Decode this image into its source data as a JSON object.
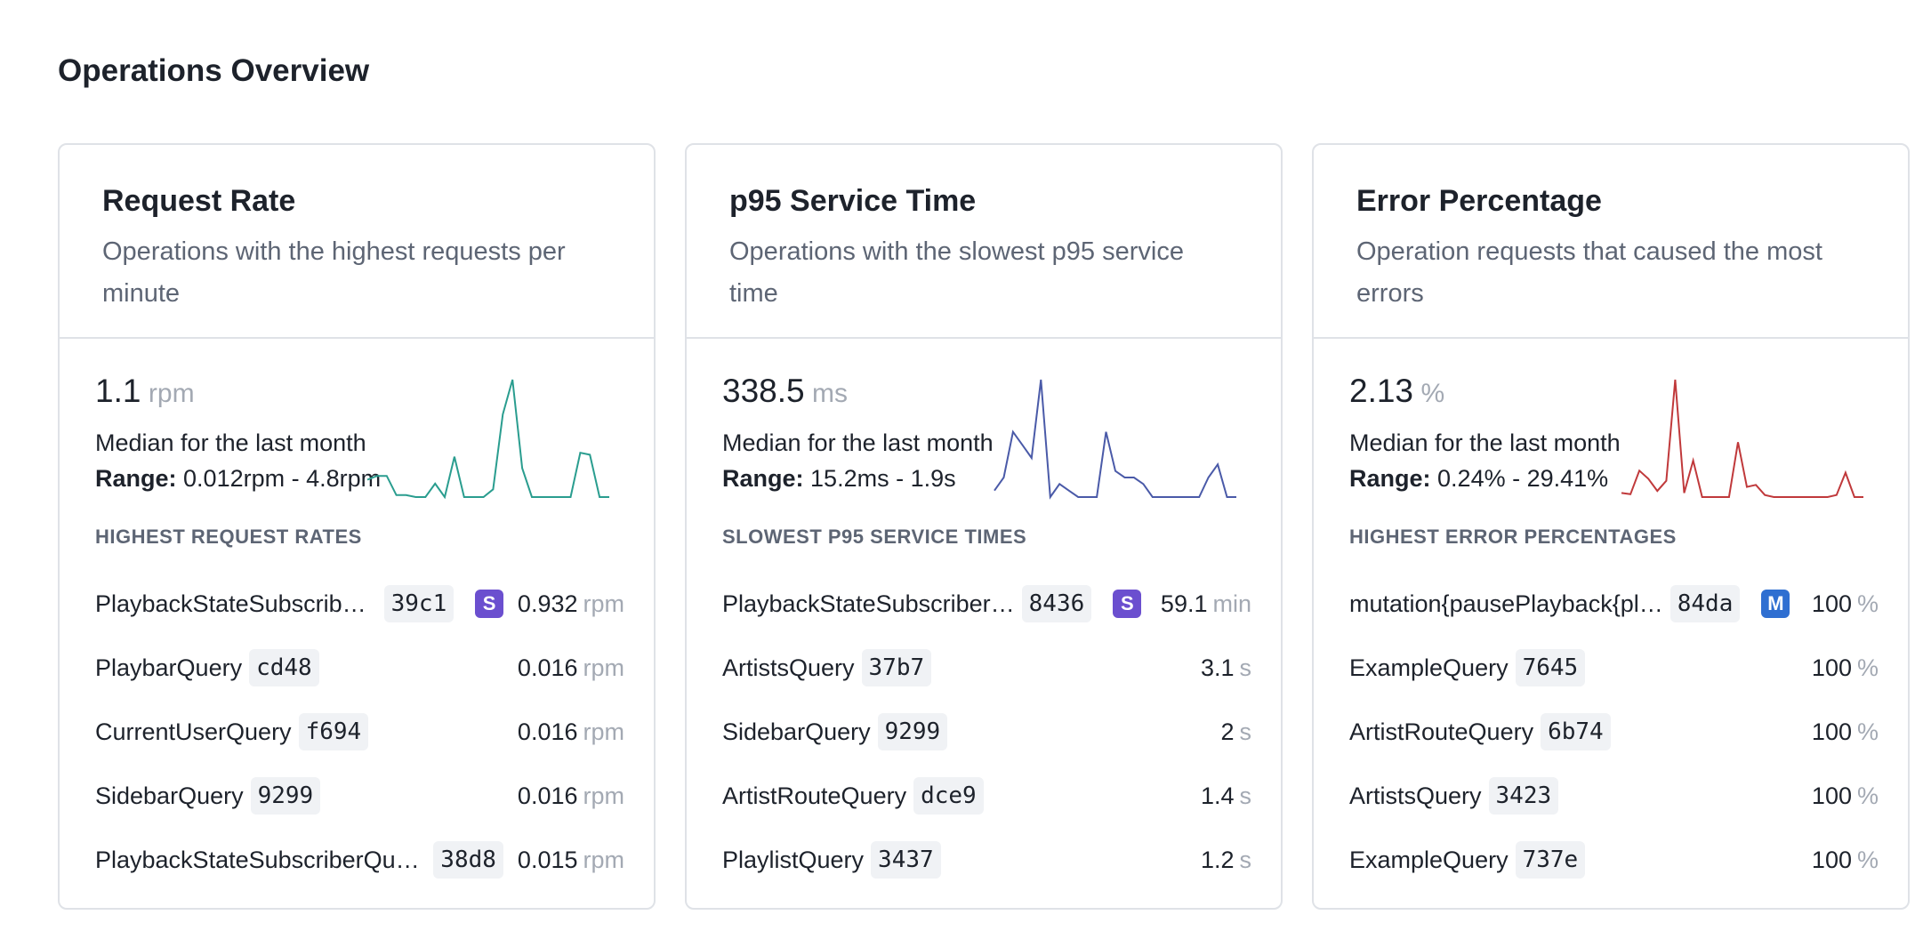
{
  "page": {
    "title": "Operations Overview"
  },
  "colors": {
    "request_rate": "#2a9d8f",
    "service_time": "#4a5aa8",
    "error_percentage": "#c0393b",
    "badge_subscription": "#6b4fcf",
    "badge_mutation": "#2f6fd1"
  },
  "cards": [
    {
      "title": "Request Rate",
      "description": "Operations with the highest requests per minute",
      "metric_value": "1.1",
      "metric_unit": "rpm",
      "median_text": "Median for the last month",
      "range_label": "Range:",
      "range_value": "0.012rpm - 4.8rpm",
      "section_label": "HIGHEST REQUEST RATES",
      "sparkline": [
        0.8,
        0.9,
        0.9,
        0.4,
        0.4,
        0.35,
        0.35,
        0.7,
        0.35,
        1.4,
        0.35,
        0.35,
        0.35,
        0.55,
        2.5,
        3.4,
        1.1,
        0.35,
        0.35,
        0.35,
        0.35,
        0.35,
        1.5,
        1.45,
        0.35,
        0.35
      ],
      "rows": [
        {
          "name": "PlaybackStateSubscribe…",
          "hash": "39c1",
          "badge": "S",
          "value": "0.932",
          "unit": "rpm"
        },
        {
          "name": "PlaybarQuery",
          "hash": "cd48",
          "badge": "",
          "value": "0.016",
          "unit": "rpm"
        },
        {
          "name": "CurrentUserQuery",
          "hash": "f694",
          "badge": "",
          "value": "0.016",
          "unit": "rpm"
        },
        {
          "name": "SidebarQuery",
          "hash": "9299",
          "badge": "",
          "value": "0.016",
          "unit": "rpm"
        },
        {
          "name": "PlaybackStateSubscriberQuery",
          "hash": "38d8",
          "badge": "",
          "value": "0.015",
          "unit": "rpm"
        }
      ]
    },
    {
      "title": "p95 Service Time",
      "description": "Operations with the slowest p95 service time",
      "metric_value": "338.5",
      "metric_unit": "ms",
      "median_text": "Median for the last month",
      "range_label": "Range:",
      "range_value": "15.2ms - 1.9s",
      "section_label": "SLOWEST P95 SERVICE TIMES",
      "sparkline": [
        0.3,
        0.5,
        1.2,
        1.0,
        0.8,
        2.0,
        0.2,
        0.4,
        0.3,
        0.2,
        0.2,
        0.2,
        1.2,
        0.6,
        0.5,
        0.5,
        0.4,
        0.2,
        0.2,
        0.2,
        0.2,
        0.2,
        0.2,
        0.5,
        0.7,
        0.2,
        0.2
      ],
      "rows": [
        {
          "name": "PlaybackStateSubscriber…",
          "hash": "8436",
          "badge": "S",
          "value": "59.1",
          "unit": "min"
        },
        {
          "name": "ArtistsQuery",
          "hash": "37b7",
          "badge": "",
          "value": "3.1",
          "unit": "s"
        },
        {
          "name": "SidebarQuery",
          "hash": "9299",
          "badge": "",
          "value": "2",
          "unit": "s"
        },
        {
          "name": "ArtistRouteQuery",
          "hash": "dce9",
          "badge": "",
          "value": "1.4",
          "unit": "s"
        },
        {
          "name": "PlaylistQuery",
          "hash": "3437",
          "badge": "",
          "value": "1.2",
          "unit": "s"
        }
      ]
    },
    {
      "title": "Error Percentage",
      "description": "Operation requests that caused the most errors",
      "metric_value": "2.13",
      "metric_unit": "%",
      "median_text": "Median for the last month",
      "range_label": "Range:",
      "range_value": "0.24% - 29.41%",
      "section_label": "HIGHEST ERROR PERCENTAGES",
      "sparkline": [
        1.5,
        1.2,
        7.0,
        5.0,
        2.0,
        4.5,
        29.4,
        1.5,
        9.5,
        0.5,
        0.5,
        0.5,
        0.5,
        14.0,
        3.0,
        3.5,
        1.0,
        0.5,
        0.5,
        0.5,
        0.5,
        0.5,
        0.5,
        0.5,
        1.0,
        6.5,
        0.5,
        0.5
      ],
      "rows": [
        {
          "name": "mutation{pausePlayback{pl…",
          "hash": "84da",
          "badge": "M",
          "value": "100",
          "unit": "%"
        },
        {
          "name": "ExampleQuery",
          "hash": "7645",
          "badge": "",
          "value": "100",
          "unit": "%"
        },
        {
          "name": "ArtistRouteQuery",
          "hash": "6b74",
          "badge": "",
          "value": "100",
          "unit": "%"
        },
        {
          "name": "ArtistsQuery",
          "hash": "3423",
          "badge": "",
          "value": "100",
          "unit": "%"
        },
        {
          "name": "ExampleQuery",
          "hash": "737e",
          "badge": "",
          "value": "100",
          "unit": "%"
        }
      ]
    }
  ]
}
